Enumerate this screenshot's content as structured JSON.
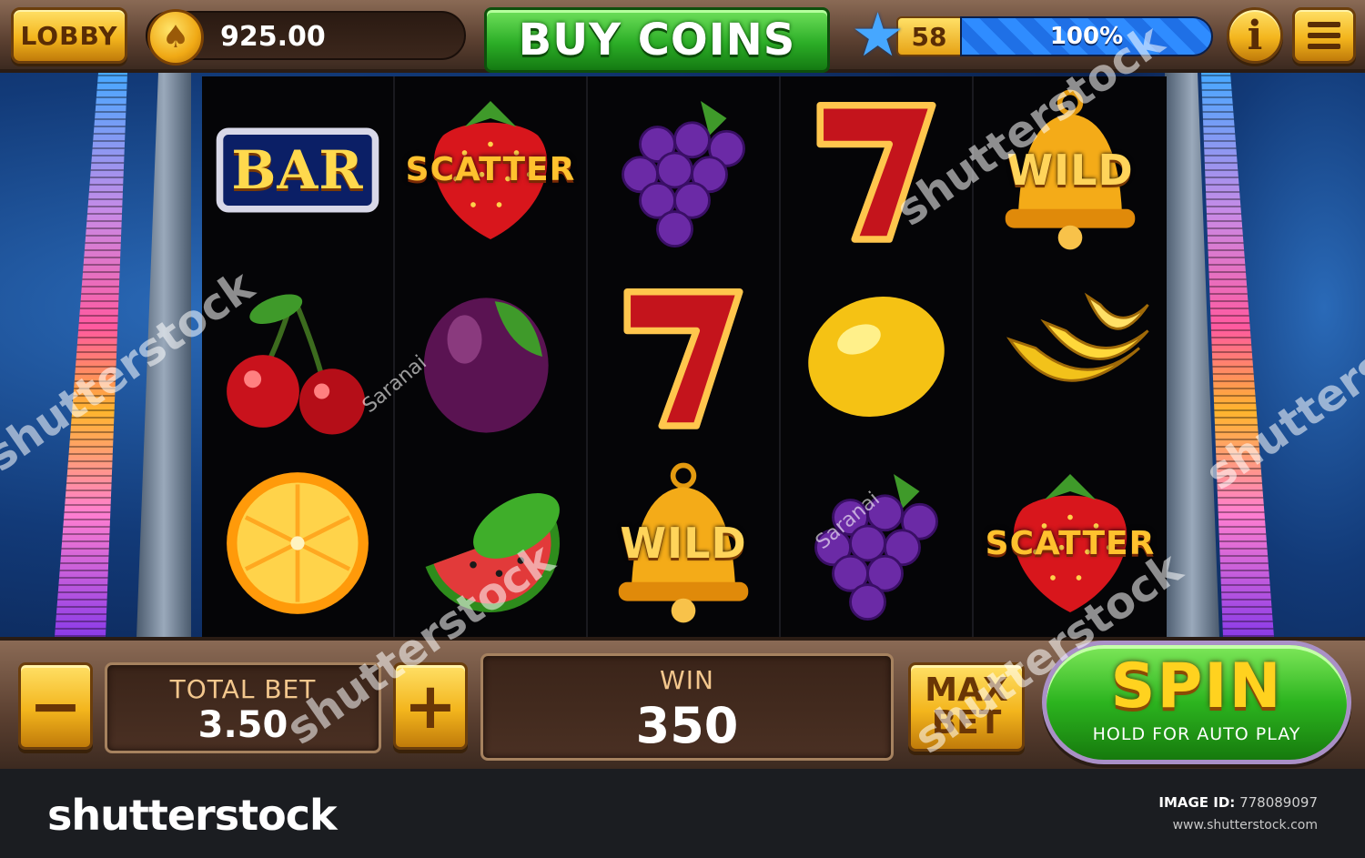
{
  "topbar": {
    "lobby_label": "LOBBY",
    "coins": "925.00",
    "buy_coins_label": "BUY COINS",
    "level": "58",
    "xp_percent_label": "100%",
    "xp_fraction": 1.0,
    "info_label": "i"
  },
  "reels": [
    [
      {
        "symbol": "bar",
        "label": "BAR"
      },
      {
        "symbol": "cherry"
      },
      {
        "symbol": "orange"
      }
    ],
    [
      {
        "symbol": "strawberry",
        "label": "SCATTER"
      },
      {
        "symbol": "plum"
      },
      {
        "symbol": "watermelon"
      }
    ],
    [
      {
        "symbol": "grapes"
      },
      {
        "symbol": "seven"
      },
      {
        "symbol": "bell",
        "label": "WILD"
      }
    ],
    [
      {
        "symbol": "seven"
      },
      {
        "symbol": "lemon"
      },
      {
        "symbol": "grapes"
      }
    ],
    [
      {
        "symbol": "bell",
        "label": "WILD"
      },
      {
        "symbol": "banana"
      },
      {
        "symbol": "strawberry",
        "label": "SCATTER"
      }
    ]
  ],
  "controls": {
    "minus_label": "−",
    "plus_label": "+",
    "total_bet_label": "TOTAL BET",
    "total_bet_value": "3.50",
    "win_label": "WIN",
    "win_value": "350",
    "max_label": "MAX",
    "bet_label": "BET",
    "spin_label": "SPIN",
    "spin_sub_label": "HOLD FOR AUTO PLAY"
  },
  "watermark": {
    "text": "shutterstock",
    "author": "Saranai"
  },
  "footer": {
    "brand": "shutterstock",
    "image_id_label": "IMAGE ID:",
    "image_id": "778089097",
    "site": "www.shutterstock.com"
  },
  "colors": {
    "gold": "#f3b51d",
    "green": "#2cae27",
    "frame_brown": "#5a3f30",
    "xp_blue": "#2f8cff"
  }
}
